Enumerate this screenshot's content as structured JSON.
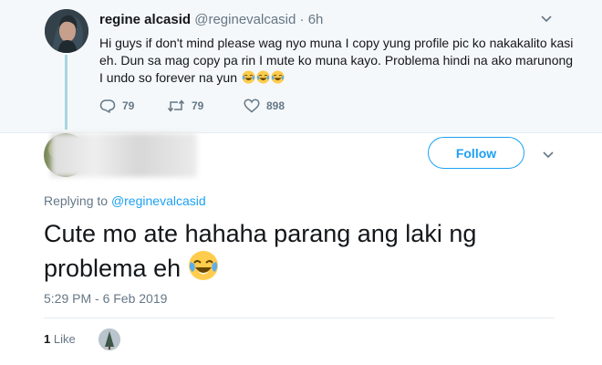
{
  "parent_tweet": {
    "display_name": "regine alcasid",
    "handle": "@reginevalcasid",
    "separator": "·",
    "time": "6h",
    "text": "Hi guys if don't mind please wag nyo muna I copy yung profile pic ko nakakalito kasi eh. Dun sa mag copy pa rin I mute ko muna kayo. Problema hindi na ako marunong I undo so forever na yun",
    "text_emoji": "face-with-tears-of-joy",
    "reply_count": "79",
    "retweet_count": "79",
    "like_count": "898"
  },
  "main_tweet": {
    "follow_label": "Follow",
    "replying_prefix": "Replying to",
    "replying_handle": "@reginevalcasid",
    "text": "Cute mo ate hahaha parang ang laki ng problema eh",
    "text_emoji": "face-with-tears-of-joy",
    "timestamp": "5:29 PM - 6 Feb 2019",
    "like_count": "1",
    "like_label": "Like"
  },
  "colors": {
    "accent": "#1da1f2",
    "muted": "#657786",
    "text": "#14171a",
    "thread_line": "#a8d6e0",
    "parent_bg": "#f5f8fa"
  }
}
